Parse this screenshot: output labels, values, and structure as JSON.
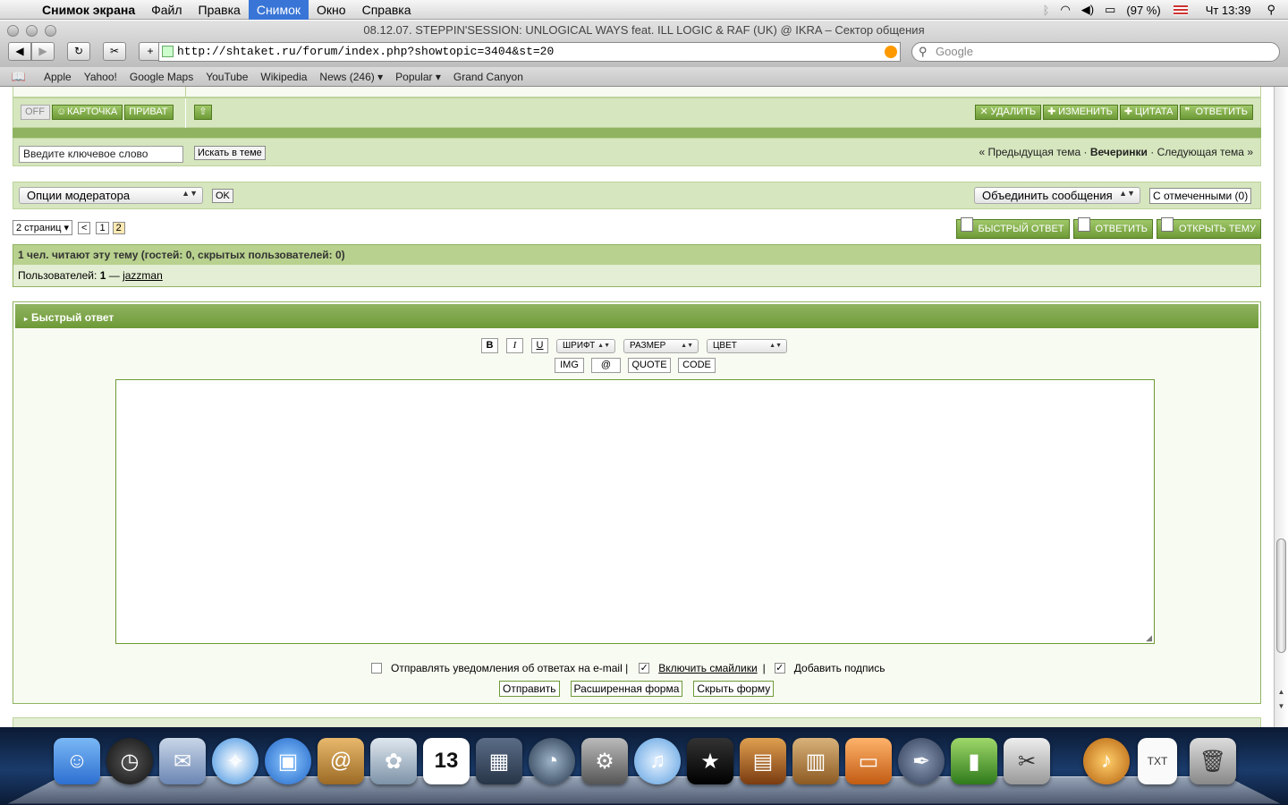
{
  "menubar": {
    "app": "Снимок экрана",
    "items": [
      "Файл",
      "Правка",
      "Снимок",
      "Окно",
      "Справка"
    ],
    "active": "Снимок",
    "battery": "(97 %)",
    "clock": "Чт 13:39"
  },
  "window": {
    "title": "08.12.07. STEPPIN'SESSION: UNLOGICAL WAYS feat. ILL LOGIC & RAF (UK) @ IKRA – Сектор общения",
    "url": "http://shtaket.ru/forum/index.php?showtopic=3404&st=20",
    "search_placeholder": "Google"
  },
  "bookmarks": [
    "Apple",
    "Yahoo!",
    "Google Maps",
    "YouTube",
    "Wikipedia",
    "News (246) ▾",
    "Popular ▾",
    "Grand Canyon"
  ],
  "post_bar": {
    "off": "OFF",
    "card": "КАРТОЧКА",
    "private": "ПРИВАТ",
    "delete": "УДАЛИТЬ",
    "edit": "ИЗМЕНИТЬ",
    "quote": "ЦИТАТА",
    "reply": "ОТВЕТИТЬ"
  },
  "topic_search": {
    "placeholder": "Введите ключевое слово",
    "button": "Искать в теме",
    "prev": "« Предыдущая тема",
    "sep": "·",
    "forum": "Вечеринки",
    "next": "Следующая тема »"
  },
  "moderator": {
    "options": "Опции модератора",
    "ok": "OK",
    "merge": "Объединить сообщения",
    "checked": "С отмеченными (0)"
  },
  "pagination": {
    "pages_select": "2 страниц ▾",
    "prev": "<",
    "page1": "1",
    "page2": "2",
    "fast_reply": "БЫСТРЫЙ ОТВЕТ",
    "reply": "ОТВЕТИТЬ",
    "new_topic": "ОТКРЫТЬ ТЕМУ"
  },
  "readers": {
    "header": "1 чел. читают эту тему (гостей: 0, скрытых пользователей: 0)",
    "users_label": "Пользователей:",
    "users_count": "1",
    "dash": "—",
    "user": "jazzman"
  },
  "quick_reply": {
    "title": "Быстрый ответ",
    "bold": "B",
    "italic": "I",
    "underline": "U",
    "font": "ШРИФТ",
    "size": "РАЗМЕР",
    "color": "ЦВЕТ",
    "img": "IMG",
    "email": "@",
    "quote": "QUOTE",
    "code": "CODE",
    "notify": "Отправлять уведомления об ответах на e-mail |",
    "smilies": "Включить смайлики",
    "sep": "|",
    "signature": "Добавить подпись",
    "submit": "Отправить",
    "advanced": "Расширенная форма",
    "hide": "Скрыть форму"
  },
  "colors": {
    "green_dark": "#6e9a37",
    "green_light": "#d6e6be",
    "menubar_active": "#3875d7"
  }
}
